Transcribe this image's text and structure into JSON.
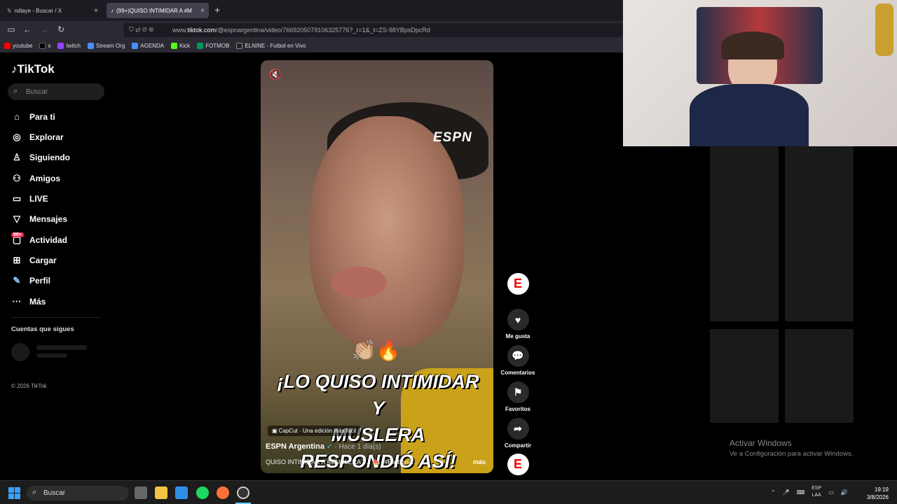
{
  "browser": {
    "tabs": [
      {
        "label": "ndiaye - Buscar / X"
      },
      {
        "label": "(99+)QUISO INTIMIDAR A #M"
      }
    ],
    "url_prefix": "www.",
    "url_domain": "tiktok.com",
    "url_path": "/@espnargentina/video/7669205079106325776?_r=1&_t=ZS-98YBpsDpcRd",
    "bookmarks": [
      "youtube",
      "x",
      "twitch",
      "Stream Org",
      "AGENDA",
      "Kick",
      "FOTMOB",
      "ELNINE - Futbol en Vivo"
    ]
  },
  "sidebar": {
    "logo": "TikTok",
    "search_placeholder": "Buscar",
    "items": [
      {
        "label": "Para ti",
        "icon": "home-icon"
      },
      {
        "label": "Explorar",
        "icon": "compass-icon"
      },
      {
        "label": "Siguiendo",
        "icon": "following-icon"
      },
      {
        "label": "Amigos",
        "icon": "friends-icon"
      },
      {
        "label": "LIVE",
        "icon": "live-icon"
      },
      {
        "label": "Mensajes",
        "icon": "messages-icon"
      },
      {
        "label": "Actividad",
        "icon": "activity-icon"
      },
      {
        "label": "Cargar",
        "icon": "upload-icon"
      },
      {
        "label": "Perfil",
        "icon": "profile-icon"
      },
      {
        "label": "Más",
        "icon": "more-icon"
      }
    ],
    "activity_badge": "99+",
    "following_heading": "Cuentas que sigues",
    "copyright": "© 2026 TikTok"
  },
  "video": {
    "watermark": "ESPN",
    "emoji": "👏🏼🔥",
    "caption_line1": "¡LO QUISO INTIMIDAR Y",
    "caption_line2": "MUSLERA RESPONDIÓ ASÍ!",
    "capcut": "CapCut · Una edición más fácil",
    "author": "ESPN Argentina",
    "time": "· Hace 1 día(s)",
    "description": "QUISO INTIMIDAR A #MUSLERA Y... 🍉 ¡#Barbona...",
    "more": "más"
  },
  "actions": {
    "like": "Me gusta",
    "comments": "Comentarios",
    "favorites": "Favoritos",
    "share": "Compartir"
  },
  "windows": {
    "activate_title": "Activar Windows",
    "activate_sub": "Ve a Configuración para activar Windows.",
    "search": "Buscar",
    "lang1": "ESP",
    "lang2": "LAA",
    "time": "19:19",
    "date": "3/8/2026"
  },
  "colors": {
    "accent": "#fe2c55",
    "espn_red": "#e00000"
  }
}
